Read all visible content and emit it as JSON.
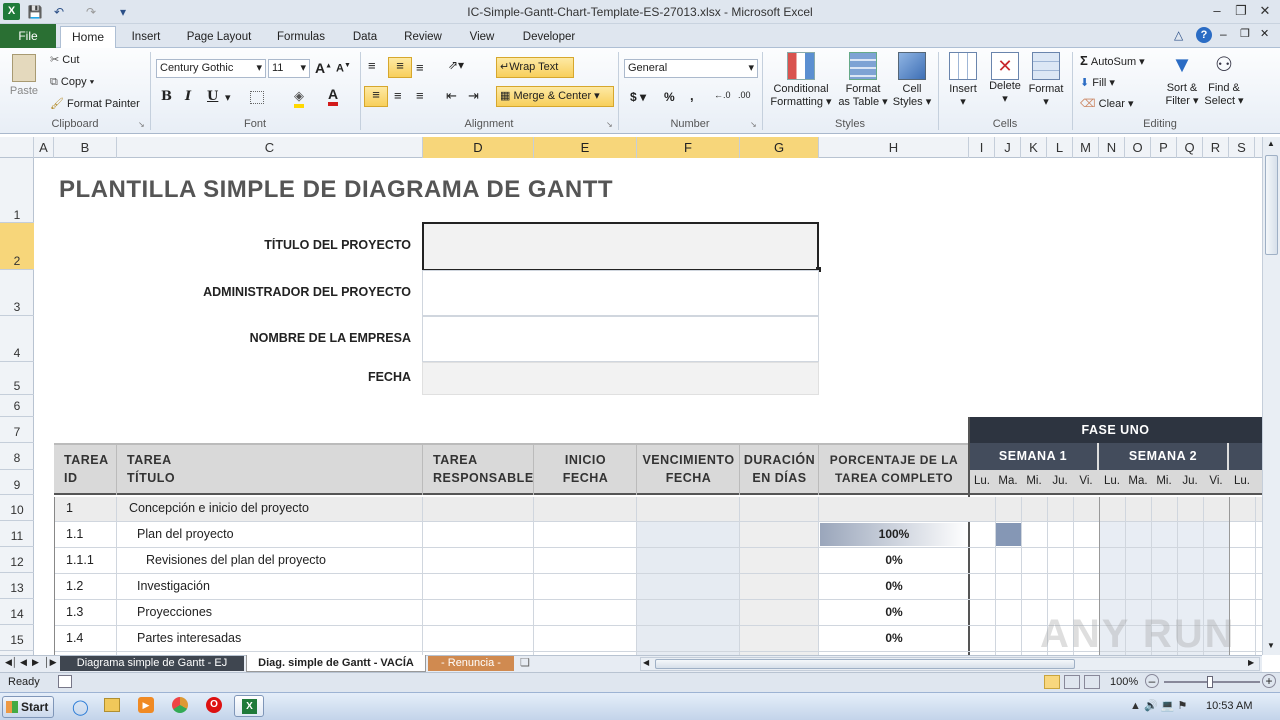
{
  "window": {
    "title": "IC-Simple-Gantt-Chart-Template-ES-27013.xlsx  -  Microsoft Excel",
    "quick_access": [
      "save-icon",
      "undo-icon",
      "redo-icon",
      "customize-icon"
    ]
  },
  "ribbon_tabs": [
    "File",
    "Home",
    "Insert",
    "Page Layout",
    "Formulas",
    "Data",
    "Review",
    "View",
    "Developer"
  ],
  "clipboard": {
    "paste": "Paste",
    "cut": "Cut",
    "copy": "Copy",
    "format_painter": "Format Painter",
    "label": "Clipboard"
  },
  "font": {
    "name": "Century Gothic",
    "size": "11",
    "label": "Font",
    "bold": "B",
    "italic": "I",
    "underline": "U"
  },
  "alignment": {
    "wrap": "Wrap Text",
    "merge": "Merge & Center",
    "label": "Alignment"
  },
  "number": {
    "format": "General",
    "currency": "$",
    "percent": "%",
    "comma": ",",
    "label": "Number"
  },
  "styles": {
    "conditional": "Conditional",
    "conditional2": "Formatting",
    "format_table": "Format",
    "format_table2": "as Table",
    "cell_styles": "Cell",
    "cell_styles2": "Styles",
    "label": "Styles"
  },
  "cells": {
    "insert": "Insert",
    "delete": "Delete",
    "format": "Format",
    "label": "Cells"
  },
  "editing": {
    "autosum": "AutoSum",
    "fill": "Fill",
    "clear": "Clear",
    "sort": "Sort &",
    "sort2": "Filter",
    "find": "Find &",
    "find2": "Select",
    "label": "Editing"
  },
  "columns": [
    "A",
    "B",
    "C",
    "D",
    "E",
    "F",
    "G",
    "H",
    "I",
    "J",
    "K",
    "L",
    "M",
    "N",
    "O",
    "P",
    "Q",
    "R",
    "S"
  ],
  "rows": [
    "1",
    "2",
    "3",
    "4",
    "5",
    "6",
    "7",
    "8",
    "9",
    "10",
    "11",
    "12",
    "13",
    "14",
    "15"
  ],
  "sheet": {
    "title": "PLANTILLA SIMPLE DE DIAGRAMA DE GANTT",
    "project_title_label": "TÍTULO DEL PROYECTO",
    "manager_label": "ADMINISTRADOR DEL PROYECTO",
    "company_label": "NOMBRE DE LA EMPRESA",
    "date_label": "FECHA",
    "phase": "FASE UNO",
    "week1": "SEMANA 1",
    "week2": "SEMANA 2",
    "days": [
      "Lu.",
      "Ma.",
      "Mi.",
      "Ju.",
      "Vi.",
      "Lu.",
      "Ma.",
      "Mi.",
      "Ju.",
      "Vi.",
      "Lu."
    ],
    "headers": {
      "id1": "TAREA",
      "id2": "ID",
      "title1": "TAREA",
      "title2": "TÍTULO",
      "resp1": "TAREA",
      "resp2": "RESPONSABLE",
      "start1": "INICIO",
      "start2": "FECHA",
      "due1": "VENCIMIENTO",
      "due2": "FECHA",
      "dur1": "DURACIÓN",
      "dur2": "EN DÍAS",
      "pct1": "PORCENTAJE DE LA",
      "pct2": "TAREA COMPLETO"
    },
    "tasks": [
      {
        "id": "1",
        "title": "Concepción e inicio del proyecto",
        "pct": ""
      },
      {
        "id": "1.1",
        "title": "Plan del proyecto",
        "pct": "100%"
      },
      {
        "id": "1.1.1",
        "title": "Revisiones del plan del proyecto",
        "pct": "0%"
      },
      {
        "id": "1.2",
        "title": "Investigación",
        "pct": "0%"
      },
      {
        "id": "1.3",
        "title": "Proyecciones",
        "pct": "0%"
      },
      {
        "id": "1.4",
        "title": "Partes interesadas",
        "pct": "0%"
      }
    ]
  },
  "sheet_tabs": [
    "Diagrama simple de Gantt - EJ",
    "Diag. simple de Gantt - VACÍA",
    "- Renuncia -"
  ],
  "status": {
    "ready": "Ready",
    "zoom": "100%"
  },
  "taskbar": {
    "start": "Start",
    "time": "10:53 AM"
  },
  "watermark": "ANY RUN",
  "colors": {
    "file_tab": "#2a6f33",
    "selected_header": "#f7d67a",
    "phase_header": "#2d3440",
    "week_header": "#434c5c",
    "progress": "#a9b4c6"
  }
}
